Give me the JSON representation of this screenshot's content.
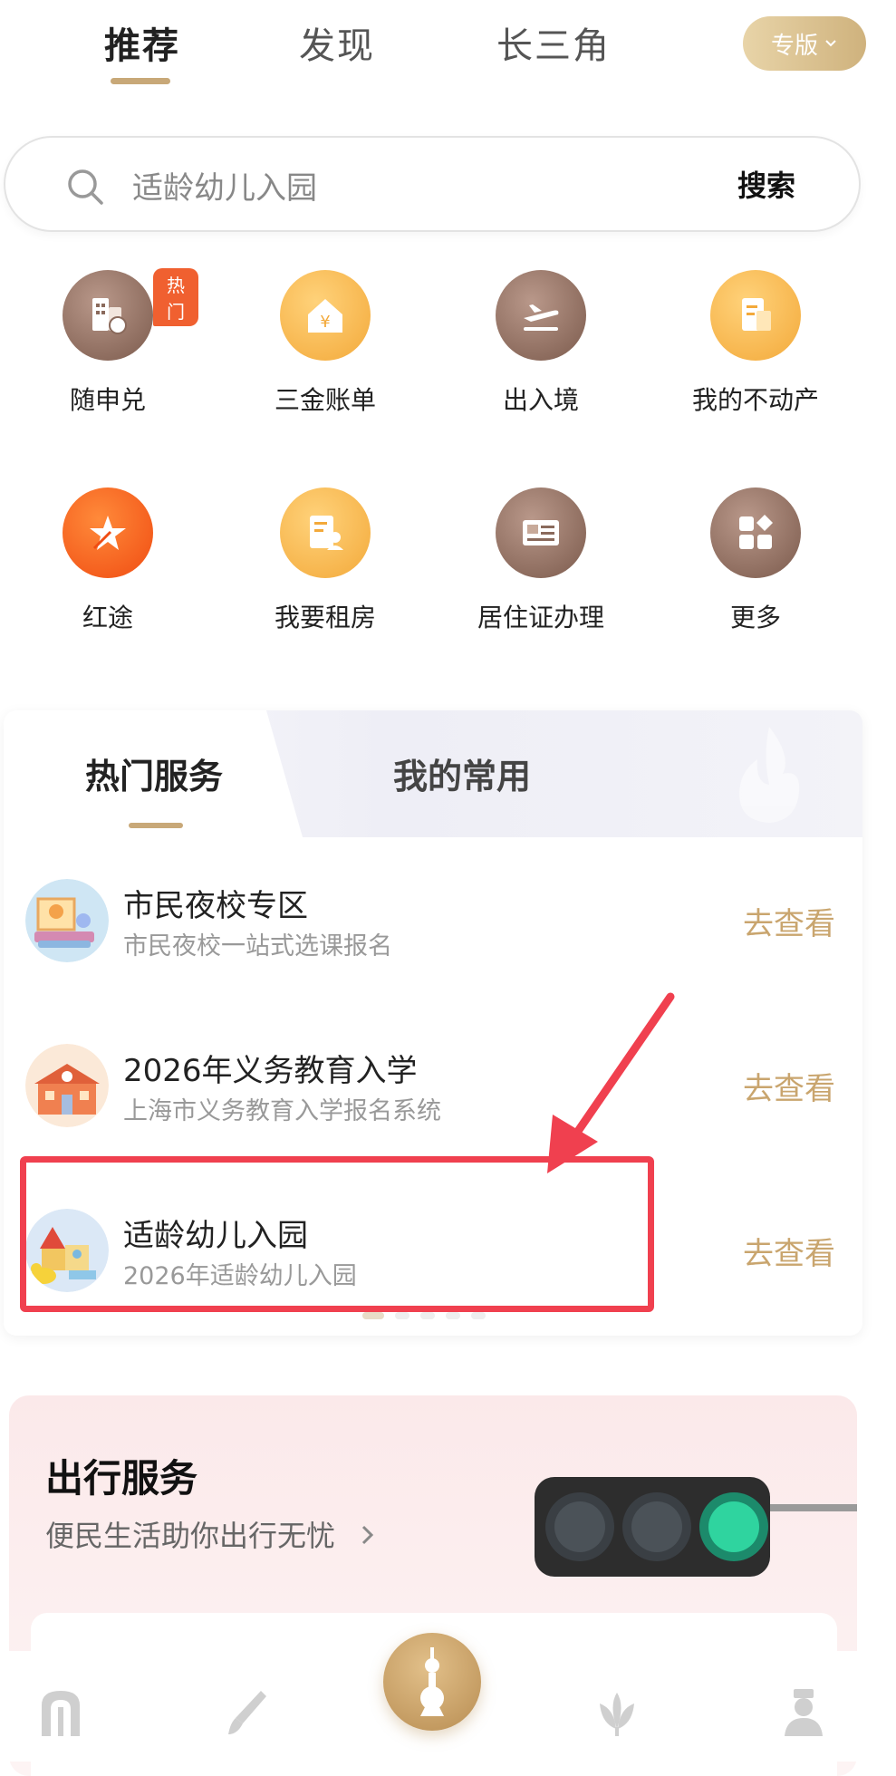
{
  "top_tabs": [
    {
      "label": "推荐",
      "active": true
    },
    {
      "label": "发现",
      "active": false
    },
    {
      "label": "长三角",
      "active": false
    }
  ],
  "edition_button": {
    "label": "专版"
  },
  "search": {
    "placeholder": "适龄幼儿入园",
    "button_label": "搜索"
  },
  "grid_items": [
    {
      "label": "随申兑",
      "icon": "building-coupon-icon",
      "badge": "热门",
      "color": "brown"
    },
    {
      "label": "三金账单",
      "icon": "yen-house-icon",
      "color": "gold"
    },
    {
      "label": "出入境",
      "icon": "airplane-icon",
      "color": "brown"
    },
    {
      "label": "我的不动产",
      "icon": "property-document-icon",
      "color": "gold"
    },
    {
      "label": "红途",
      "icon": "red-star-icon",
      "color": "orange"
    },
    {
      "label": "我要租房",
      "icon": "rental-icon",
      "color": "gold"
    },
    {
      "label": "居住证办理",
      "icon": "residence-card-icon",
      "color": "brown"
    },
    {
      "label": "更多",
      "icon": "more-grid-icon",
      "color": "brown"
    }
  ],
  "service_tabs": [
    {
      "label": "热门服务",
      "active": true
    },
    {
      "label": "我的常用",
      "active": false
    }
  ],
  "services": [
    {
      "title": "市民夜校专区",
      "subtitle": "市民夜校一站式选课报名",
      "link": "去查看",
      "thumb": "night-school-thumb"
    },
    {
      "title": "2026年义务教育入学",
      "subtitle": "上海市义务教育入学报名系统",
      "link": "去查看",
      "thumb": "school-building-thumb"
    },
    {
      "title": "适龄幼儿入园",
      "subtitle": "2026年适龄幼儿入园",
      "link": "去查看",
      "thumb": "toy-blocks-thumb"
    }
  ],
  "travel": {
    "title": "出行服务",
    "subtitle": "便民生活助你出行无忧"
  },
  "bottom_nav": [
    {
      "name": "arch-icon"
    },
    {
      "name": "brush-icon"
    },
    {
      "name": "oriental-pearl-tower-icon"
    },
    {
      "name": "magnolia-icon"
    },
    {
      "name": "person-icon"
    }
  ],
  "colors": {
    "accent_gold": "#c8a878",
    "link_gold": "#c9a56e",
    "highlight_red": "#f0404f",
    "hot_orange": "#f06030"
  }
}
